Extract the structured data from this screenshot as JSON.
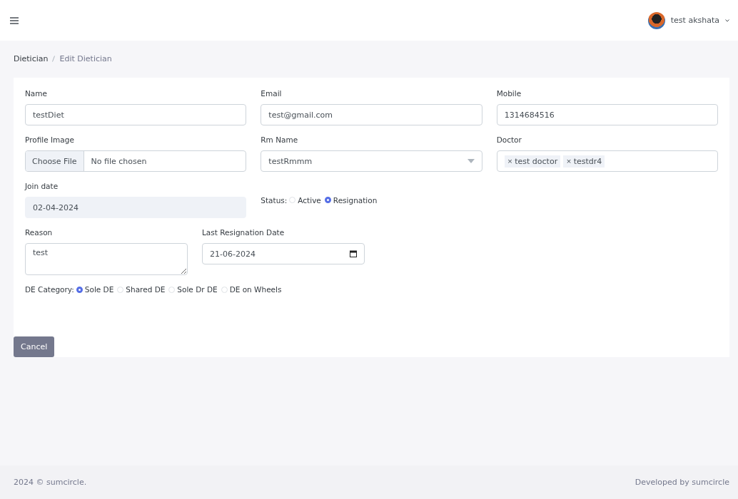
{
  "header": {
    "user_name": "test akshata"
  },
  "breadcrumb": [
    {
      "label": "Dietician",
      "current": false
    },
    {
      "label": "Edit Dietician",
      "current": true
    }
  ],
  "form": {
    "row_1": [
      {
        "kind": "text",
        "label": "Name",
        "value": "testDiet"
      },
      {
        "kind": "text",
        "label": "Email",
        "value": "test@gmail.com"
      },
      {
        "kind": "text",
        "label": "Mobile",
        "value": "1314684516"
      }
    ],
    "row_2": [
      {
        "kind": "file",
        "label": "Profile Image",
        "button": "Choose File",
        "value": "No file chosen"
      },
      {
        "kind": "select",
        "label": "Rm Name",
        "value": "testRmmm"
      },
      {
        "kind": "tags",
        "label": "Doctor",
        "tags": [
          {
            "remove": "×",
            "label": "test doctor"
          },
          {
            "remove": "×",
            "label": "testdr4"
          }
        ]
      }
    ],
    "join_date": {
      "label": "Join date",
      "value": "02-04-2024",
      "disabled": true
    },
    "status": {
      "label": "Status:",
      "options": [
        {
          "label": "Active",
          "selected": false
        },
        {
          "label": "Resignation",
          "selected": true
        }
      ]
    },
    "reason": {
      "label": "Reason",
      "value": "test"
    },
    "last_resignation_date": {
      "label": "Last Resignation Date",
      "value": "21-06-2024"
    },
    "de_category": {
      "label": "DE Category:",
      "options": [
        {
          "label": "Sole DE",
          "selected": true
        },
        {
          "label": "Shared DE",
          "selected": false
        },
        {
          "label": "Sole Dr DE",
          "selected": false
        },
        {
          "label": "DE on Wheels",
          "selected": false
        }
      ]
    },
    "cancel_button": "Cancel"
  },
  "footer": {
    "copyright": "2024 © sumcircle.",
    "credit": "Developed by sumcircle"
  }
}
